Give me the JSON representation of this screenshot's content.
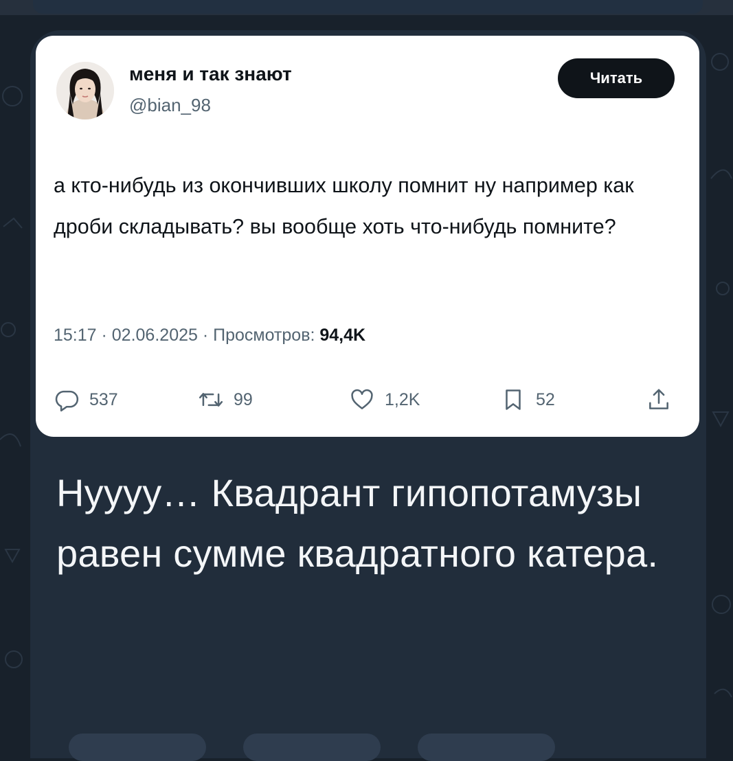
{
  "tweet": {
    "display_name": "меня и так знают",
    "handle": "@bian_98",
    "follow_label": "Читать",
    "text": "а кто-нибудь из окончивших школу помнит ну например как дроби складывать? вы вообще хоть что-нибудь помните?",
    "timestamp": "15:17 · 02.06.2025 · Просмотров:",
    "views": "94,4K",
    "replies": "537",
    "retweets": "99",
    "likes": "1,2K",
    "bookmarks": "52"
  },
  "caption": {
    "text": "Нуууу… Квадрант гипопотамузы равен сумме квадратного катера."
  },
  "colors": {
    "background": "#18212b",
    "bubble": "#212d3b",
    "card": "#ffffff",
    "primary_text": "#0f1419",
    "secondary_text": "#536471",
    "caption_text": "#f4f6f8"
  },
  "icons": [
    "reply-icon",
    "retweet-icon",
    "like-icon",
    "bookmark-icon",
    "share-icon"
  ]
}
